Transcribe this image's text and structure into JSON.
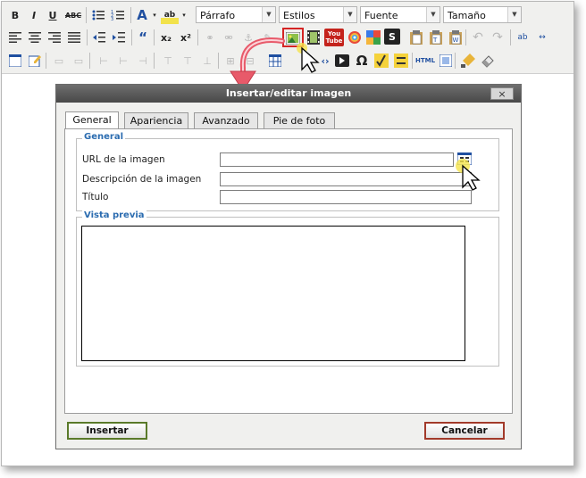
{
  "toolbar": {
    "format_select": "Párrafo",
    "styles_select": "Estilos",
    "font_select": "Fuente",
    "size_select": "Tamaño",
    "bold": "B",
    "italic": "I",
    "underline": "U",
    "strike": "ABC",
    "quote": "“",
    "subscript": "x₂",
    "superscript": "x²",
    "text_color": "A",
    "highlight": "ab",
    "omega": "Ω",
    "html": "HTML",
    "youtube": "You Tube",
    "scribd": "S"
  },
  "dialog": {
    "title": "Insertar/editar imagen",
    "close": "×",
    "tabs": [
      "General",
      "Apariencia",
      "Avanzado",
      "Pie de foto"
    ],
    "general_legend": "General",
    "url_label": "URL de la imagen",
    "url_value": "",
    "description_label": "Descripción de la imagen",
    "description_value": "",
    "title_label": "Título",
    "title_value": "",
    "preview_legend": "Vista previa",
    "insert_button": "Insertar",
    "cancel_button": "Cancelar"
  },
  "colors": {
    "highlight_border": "#d42424",
    "arrow": "#e85a6a",
    "legend_text": "#2b6cb0",
    "insert_border": "#5a7a2a",
    "cancel_border": "#a23a2a"
  }
}
